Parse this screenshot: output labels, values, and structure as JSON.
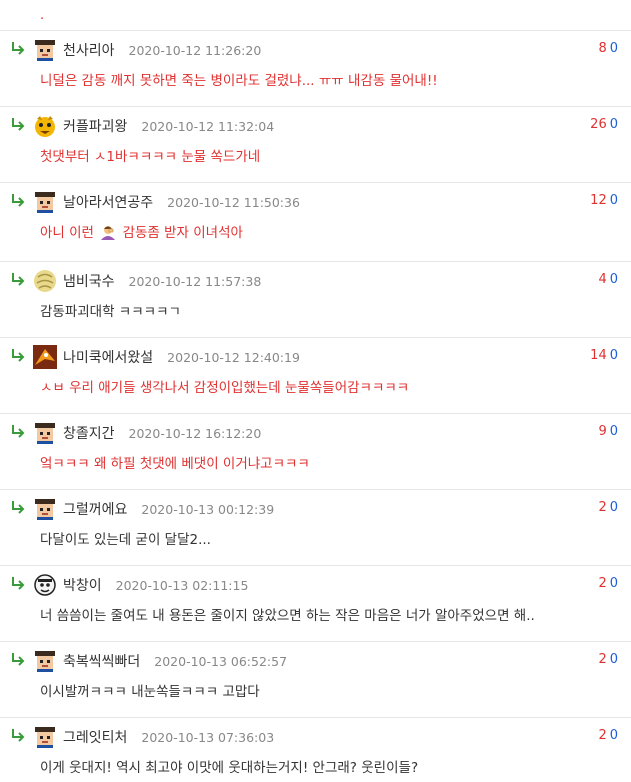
{
  "top_fragment": ".",
  "comments": [
    {
      "nick": "천사리아",
      "date": "2020-10-12 11:26:20",
      "up": "8",
      "down": "0",
      "text": "니덜은 감동 깨지 못하면 죽는 병이라도 걸렸냐... ㅠㅠ 내감동 물어내!!",
      "red": true,
      "avatar": "pixel-hat"
    },
    {
      "nick": "커플파괴왕",
      "date": "2020-10-12 11:32:04",
      "up": "26",
      "down": "0",
      "text": "첫댓부터 ㅅ1바ㅋㅋㅋㅋ 눈물 쏙드가네",
      "red": true,
      "avatar": "yellow-monster"
    },
    {
      "nick": "날아라서연공주",
      "date": "2020-10-12 11:50:36",
      "up": "12",
      "down": "0",
      "text_before": "아니 이런",
      "text_after": "감동좀 받자 이녀석아",
      "red": true,
      "avatar": "pixel-hat",
      "emoji": "facepalm-person-emoji"
    },
    {
      "nick": "냄비국수",
      "date": "2020-10-12 11:57:38",
      "up": "4",
      "down": "0",
      "text": "감동파괴대학 ㅋㅋㅋㅋㄱ",
      "red": false,
      "avatar": "yellow-ball"
    },
    {
      "nick": "나미쿡에서왔설",
      "date": "2020-10-12 12:40:19",
      "up": "14",
      "down": "0",
      "text": "ㅅㅂ 우리 애기들 생각나서 감정이입했는데 눈물쏙들어감ㅋㅋㅋㅋ",
      "red": true,
      "avatar": "orange-creature"
    },
    {
      "nick": "창졸지간",
      "date": "2020-10-12 16:12:20",
      "up": "9",
      "down": "0",
      "text": "엌ㅋㅋㅋ 왜 하필 첫댓에 베댓이 이거냐고ㅋㅋㅋ",
      "red": true,
      "avatar": "pixel-hat"
    },
    {
      "nick": "그럴꺼에요",
      "date": "2020-10-13 00:12:39",
      "up": "2",
      "down": "0",
      "text": "다달이도 있는데 굳이 달달2...",
      "red": false,
      "avatar": "pixel-hat"
    },
    {
      "nick": "박창이",
      "date": "2020-10-13 02:11:15",
      "up": "2",
      "down": "0",
      "text": "너 씀씀이는 줄여도 내 용돈은 줄이지 않았으면 하는 작은 마음은 너가 알아주었으면 해..",
      "red": false,
      "avatar": "sketch-face"
    },
    {
      "nick": "축복씩씩빠더",
      "date": "2020-10-13 06:52:57",
      "up": "2",
      "down": "0",
      "text": "이시발꺼ㅋㅋㅋ 내눈쏙들ㅋㅋㅋ 고맙다",
      "red": false,
      "avatar": "pixel-hat"
    },
    {
      "nick": "그레잇티처",
      "date": "2020-10-13 07:36:03",
      "up": "2",
      "down": "0",
      "text": "이게 웃대지! 역시 최고야 이맛에 웃대하는거지! 안그래? 웃린이들?",
      "red": false,
      "avatar": "pixel-hat"
    }
  ]
}
